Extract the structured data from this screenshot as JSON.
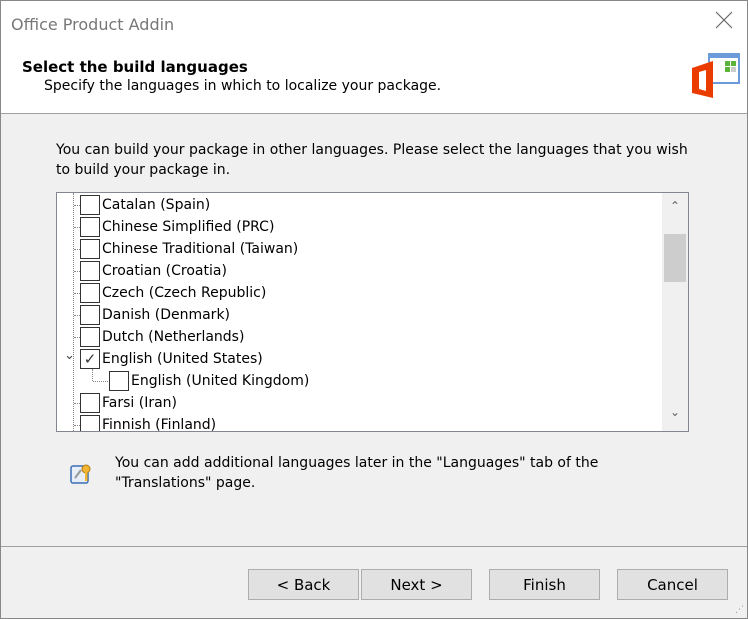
{
  "window": {
    "title": "Office Product Addin"
  },
  "header": {
    "title": "Select the build languages",
    "subtitle": "Specify the languages in which to localize your package."
  },
  "intro": "You can build your package in other languages. Please select the languages that you wish to build your package in.",
  "languages": [
    {
      "label": "Catalan (Spain)",
      "checked": false
    },
    {
      "label": "Chinese Simplified (PRC)",
      "checked": false
    },
    {
      "label": "Chinese Traditional (Taiwan)",
      "checked": false
    },
    {
      "label": "Croatian (Croatia)",
      "checked": false
    },
    {
      "label": "Czech (Czech Republic)",
      "checked": false
    },
    {
      "label": "Danish (Denmark)",
      "checked": false
    },
    {
      "label": "Dutch (Netherlands)",
      "checked": false
    },
    {
      "label": "English (United States)",
      "checked": true,
      "expanded": true
    },
    {
      "label": "English (United Kingdom)",
      "checked": false,
      "child": true
    },
    {
      "label": "Farsi (Iran)",
      "checked": false
    },
    {
      "label": "Finnish (Finland)",
      "checked": false
    }
  ],
  "info": "You can add additional languages later in the \"Languages\" tab of the \"Translations\" page.",
  "buttons": {
    "back": "< Back",
    "next": "Next >",
    "finish": "Finish",
    "cancel": "Cancel"
  },
  "icons": {
    "close": "×",
    "check": "✓",
    "expand": "⌄",
    "up": "⌃",
    "down": "⌄"
  },
  "colors": {
    "office": "#eb3c00",
    "addin_blue": "#6b9bd8",
    "addin_green": "#5bb33a"
  }
}
